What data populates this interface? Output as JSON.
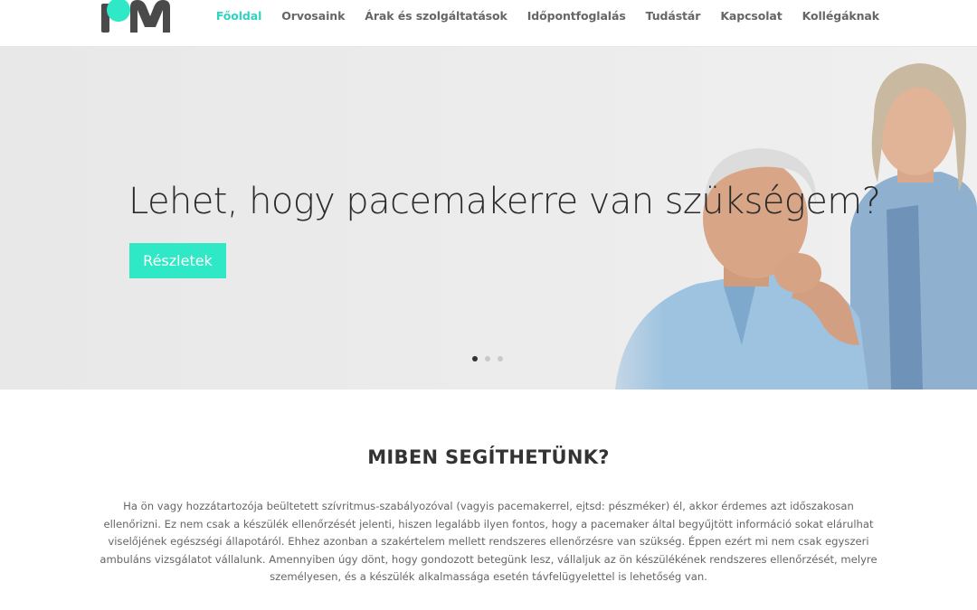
{
  "header": {
    "logo_text": "PM",
    "nav": [
      {
        "label": "Főoldal",
        "active": true
      },
      {
        "label": "Orvosaink",
        "active": false
      },
      {
        "label": "Árak és szolgáltatások",
        "active": false
      },
      {
        "label": "Időpontfoglalás",
        "active": false
      },
      {
        "label": "Tudástár",
        "active": false
      },
      {
        "label": "Kapcsolat",
        "active": false
      },
      {
        "label": "Kollégáknak",
        "active": false
      }
    ]
  },
  "hero": {
    "title": "Lehet, hogy pacemakerre van szükségem?",
    "button_label": "Részletek",
    "slides": 3,
    "active_slide": 1
  },
  "section": {
    "title": "MIBEN SEGÍTHETÜNK?",
    "body": "Ha ön vagy hozzátartozója beültetett szívritmus-szabályozóval (vagyis pacemakerrel, ejtsd: pészméker) él, akkor érdemes azt időszakosan ellenőrizni. Ez nem csak a készülék ellenőrzését jelenti, hiszen legalább ilyen fontos, hogy a pacemaker által begyűjtött információ sokat elárulhat viselőjének egészségi állapotáról. Ehhez azonban a szakértelem mellett rendszeres ellenőrzésre van szükség. Éppen ezért mi nem csak egyszeri ambuláns vizsgálatot vállalunk. Amennyiben úgy dönt, hogy gondozott betegünk lesz, vállaljuk az ön készülékének rendszeres ellenőrzését, melyre személyesen, és a készülék alkalmassága esetén távfelügyelettel is lehetőség van."
  },
  "colors": {
    "accent": "#2ed3c2",
    "button": "#2ee8c6",
    "logo_teal": "#2ee8c6",
    "logo_gray": "#4a4a4a"
  }
}
